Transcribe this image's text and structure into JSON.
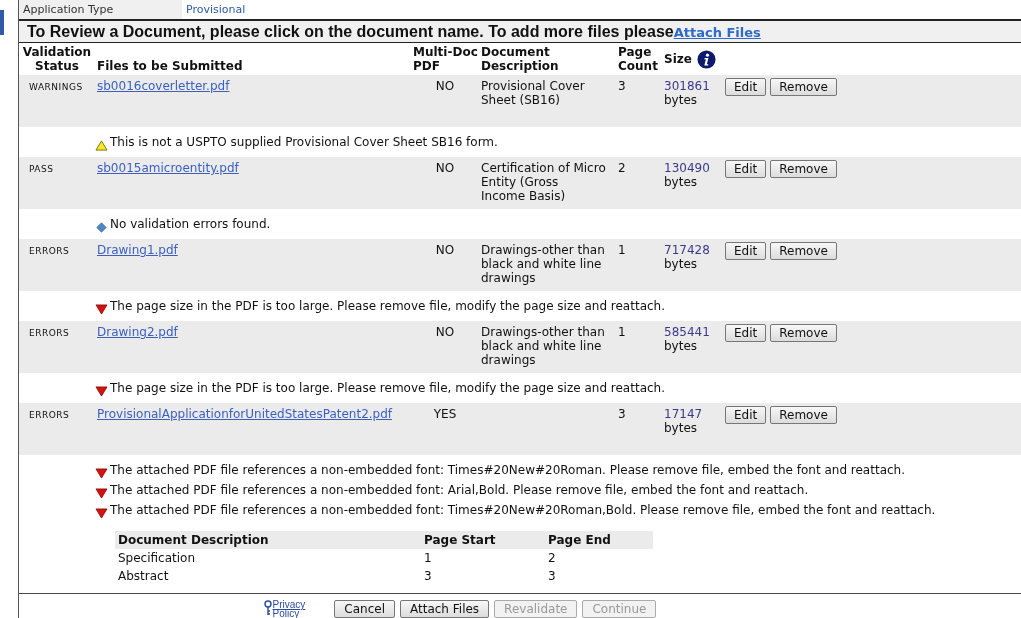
{
  "top_row": {
    "label": "Application Type",
    "value": "Provisional"
  },
  "banner": {
    "text": "To Review a Document, please click on the document name. To add more files please",
    "link": "Attach Files"
  },
  "columns": {
    "status": [
      "Validation",
      "Status"
    ],
    "file": "Files to be Submitted",
    "multi": [
      "Multi-Doc",
      "PDF"
    ],
    "description": [
      "Document",
      "Description"
    ],
    "count": [
      "Page",
      "Count"
    ],
    "size": "Size"
  },
  "files": [
    {
      "status": "WARNINGS",
      "name": "sb0016coverletter.pdf",
      "multi_doc": "NO",
      "description": "Provisional Cover Sheet (SB16)",
      "page_count": "3",
      "size": "301861",
      "unit": "bytes",
      "edit": "Edit",
      "remove": "Remove",
      "messages": [
        {
          "kind": "warning",
          "text": "This is not a USPTO supplied Provisional Cover Sheet SB16 form."
        }
      ]
    },
    {
      "status": "PASS",
      "name": "sb0015amicroentity.pdf",
      "multi_doc": "NO",
      "description": "Certification of Micro Entity (Gross Income Basis)",
      "page_count": "2",
      "size": "130490",
      "unit": "bytes",
      "edit": "Edit",
      "remove": "Remove",
      "messages": [
        {
          "kind": "info",
          "text": "No validation errors found."
        }
      ]
    },
    {
      "status": "ERRORS",
      "name": "Drawing1.pdf",
      "multi_doc": "NO",
      "description": "Drawings-other than black and white line drawings",
      "page_count": "1",
      "size": "717428",
      "unit": "bytes",
      "edit": "Edit",
      "remove": "Remove",
      "messages": [
        {
          "kind": "error",
          "text": "The page size in the PDF is too large. Please remove file, modify the page size and reattach."
        }
      ]
    },
    {
      "status": "ERRORS",
      "name": "Drawing2.pdf",
      "multi_doc": "NO",
      "description": "Drawings-other than black and white line drawings",
      "page_count": "1",
      "size": "585441",
      "unit": "bytes",
      "edit": "Edit",
      "remove": "Remove",
      "messages": [
        {
          "kind": "error",
          "text": "The page size in the PDF is too large. Please remove file, modify the page size and reattach."
        }
      ]
    },
    {
      "status": "ERRORS",
      "name": "ProvisionalApplicationforUnitedStatesPatent2.pdf",
      "multi_doc": "YES",
      "page_count": "3",
      "size": "17147",
      "unit": "bytes",
      "edit": "Edit",
      "remove": "Remove",
      "messages": [
        {
          "kind": "error",
          "text": "The attached PDF file references a non-embedded font: Times#20New#20Roman. Please remove file, embed the font and reattach."
        },
        {
          "kind": "error",
          "text": "The attached PDF file references a non-embedded font: Arial,Bold. Please remove file, embed the font and reattach."
        },
        {
          "kind": "error",
          "text": "The attached PDF file references a non-embedded font: Times#20New#20Roman,Bold. Please remove file, embed the font and reattach."
        }
      ],
      "sections": {
        "columns": [
          "Document Description",
          "Page Start",
          "Page End"
        ],
        "rows": [
          [
            "Specification",
            "1",
            "2"
          ],
          [
            "Abstract",
            "3",
            "3"
          ]
        ]
      }
    }
  ],
  "footer": {
    "privacy": [
      "Privacy",
      "Policy"
    ],
    "buttons": [
      {
        "label": "Cancel",
        "disabled": false
      },
      {
        "label": "Attach Files",
        "disabled": false
      },
      {
        "label": "Revalidate",
        "disabled": true
      },
      {
        "label": "Continue",
        "disabled": true
      }
    ]
  }
}
